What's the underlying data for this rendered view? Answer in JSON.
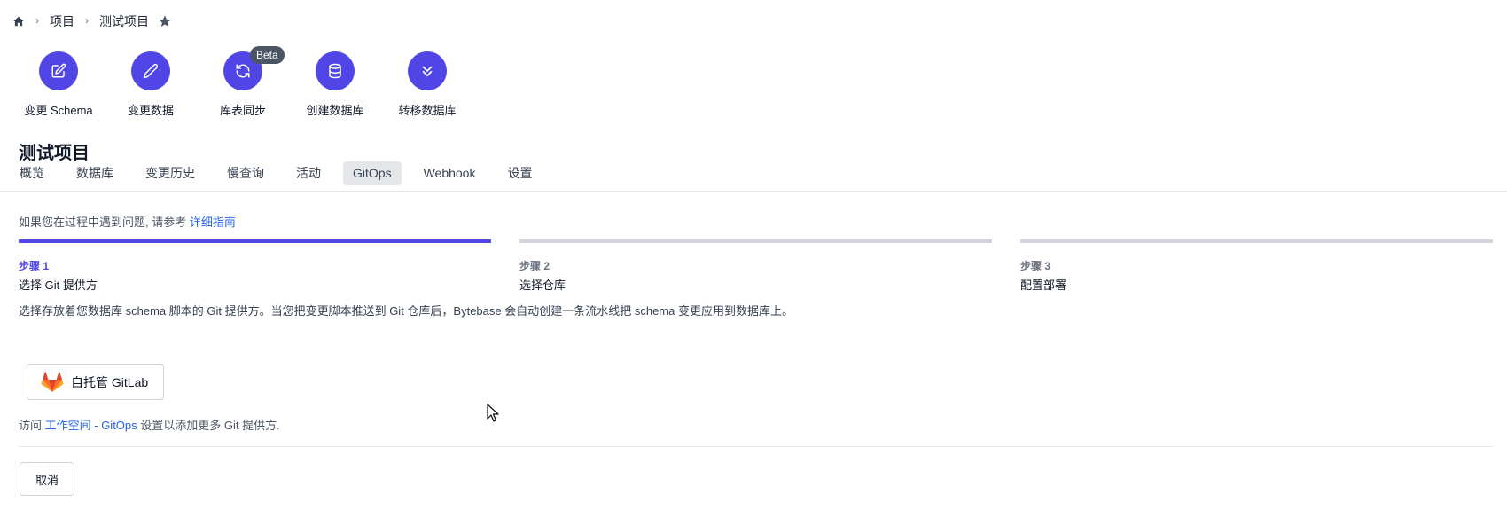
{
  "breadcrumb": {
    "home_icon": "home-icon",
    "items": [
      "项目",
      "测试项目"
    ],
    "star_icon": "star-icon"
  },
  "quick_actions": [
    {
      "label": "变更 Schema",
      "icon": "edit-square-icon"
    },
    {
      "label": "变更数据",
      "icon": "pencil-icon"
    },
    {
      "label": "库表同步",
      "icon": "refresh-icon",
      "badge": "Beta"
    },
    {
      "label": "创建数据库",
      "icon": "database-icon"
    },
    {
      "label": "转移数据库",
      "icon": "double-chevron-down-icon"
    }
  ],
  "project": {
    "title": "测试项目"
  },
  "tabs": [
    "概览",
    "数据库",
    "变更历史",
    "慢查询",
    "活动",
    "GitOps",
    "Webhook",
    "设置"
  ],
  "active_tab": "GitOps",
  "hint": {
    "text": "如果您在过程中遇到问题, 请参考",
    "link": "详细指南"
  },
  "steps": [
    {
      "number": "步骤 1",
      "name": "选择 Git 提供方",
      "current": true
    },
    {
      "number": "步骤 2",
      "name": "选择仓库",
      "current": false
    },
    {
      "number": "步骤 3",
      "name": "配置部署",
      "current": false
    }
  ],
  "description": "选择存放着您数据库 schema 脚本的 Git 提供方。当您把变更脚本推送到 Git 仓库后，Bytebase 会自动创建一条流水线把 schema 变更应用到数据库上。",
  "provider": {
    "label": "自托管 GitLab",
    "icon": "gitlab-icon"
  },
  "visit": {
    "prefix": "访问",
    "link": "工作空间 - GitOps",
    "suffix": "设置以添加更多 Git 提供方."
  },
  "footer": {
    "cancel_label": "取消"
  },
  "colors": {
    "accent": "#4f46e5",
    "link": "#2563eb",
    "inactive_step": "#d1d5db"
  }
}
